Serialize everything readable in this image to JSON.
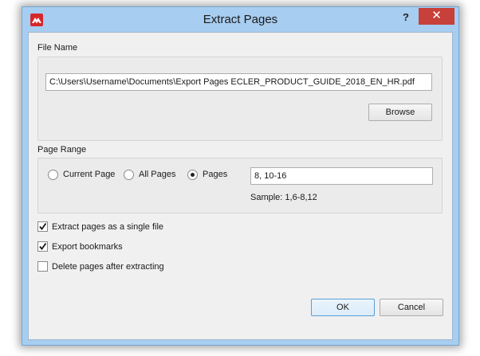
{
  "window": {
    "title": "Extract Pages",
    "help_label": "?",
    "close_label": "✕"
  },
  "file_name": {
    "section_label": "File Name",
    "path_value": "C:\\Users\\Username\\Documents\\Export Pages ECLER_PRODUCT_GUIDE_2018_EN_HR.pdf",
    "browse_label": "Browse"
  },
  "page_range": {
    "section_label": "Page Range",
    "options": [
      {
        "label": "Current Page",
        "selected": false
      },
      {
        "label": "All Pages",
        "selected": false
      },
      {
        "label": "Pages",
        "selected": true
      }
    ],
    "pages_value": "8, 10-16",
    "sample_text": "Sample: 1,6-8,12"
  },
  "options": [
    {
      "label": "Extract pages as a single file",
      "checked": true
    },
    {
      "label": "Export bookmarks",
      "checked": true
    },
    {
      "label": "Delete pages after extracting",
      "checked": false
    }
  ],
  "buttons": {
    "ok_label": "OK",
    "cancel_label": "Cancel"
  },
  "colors": {
    "frame": "#a7cdf0",
    "close": "#c7403a",
    "app_icon": "#d6262b"
  }
}
